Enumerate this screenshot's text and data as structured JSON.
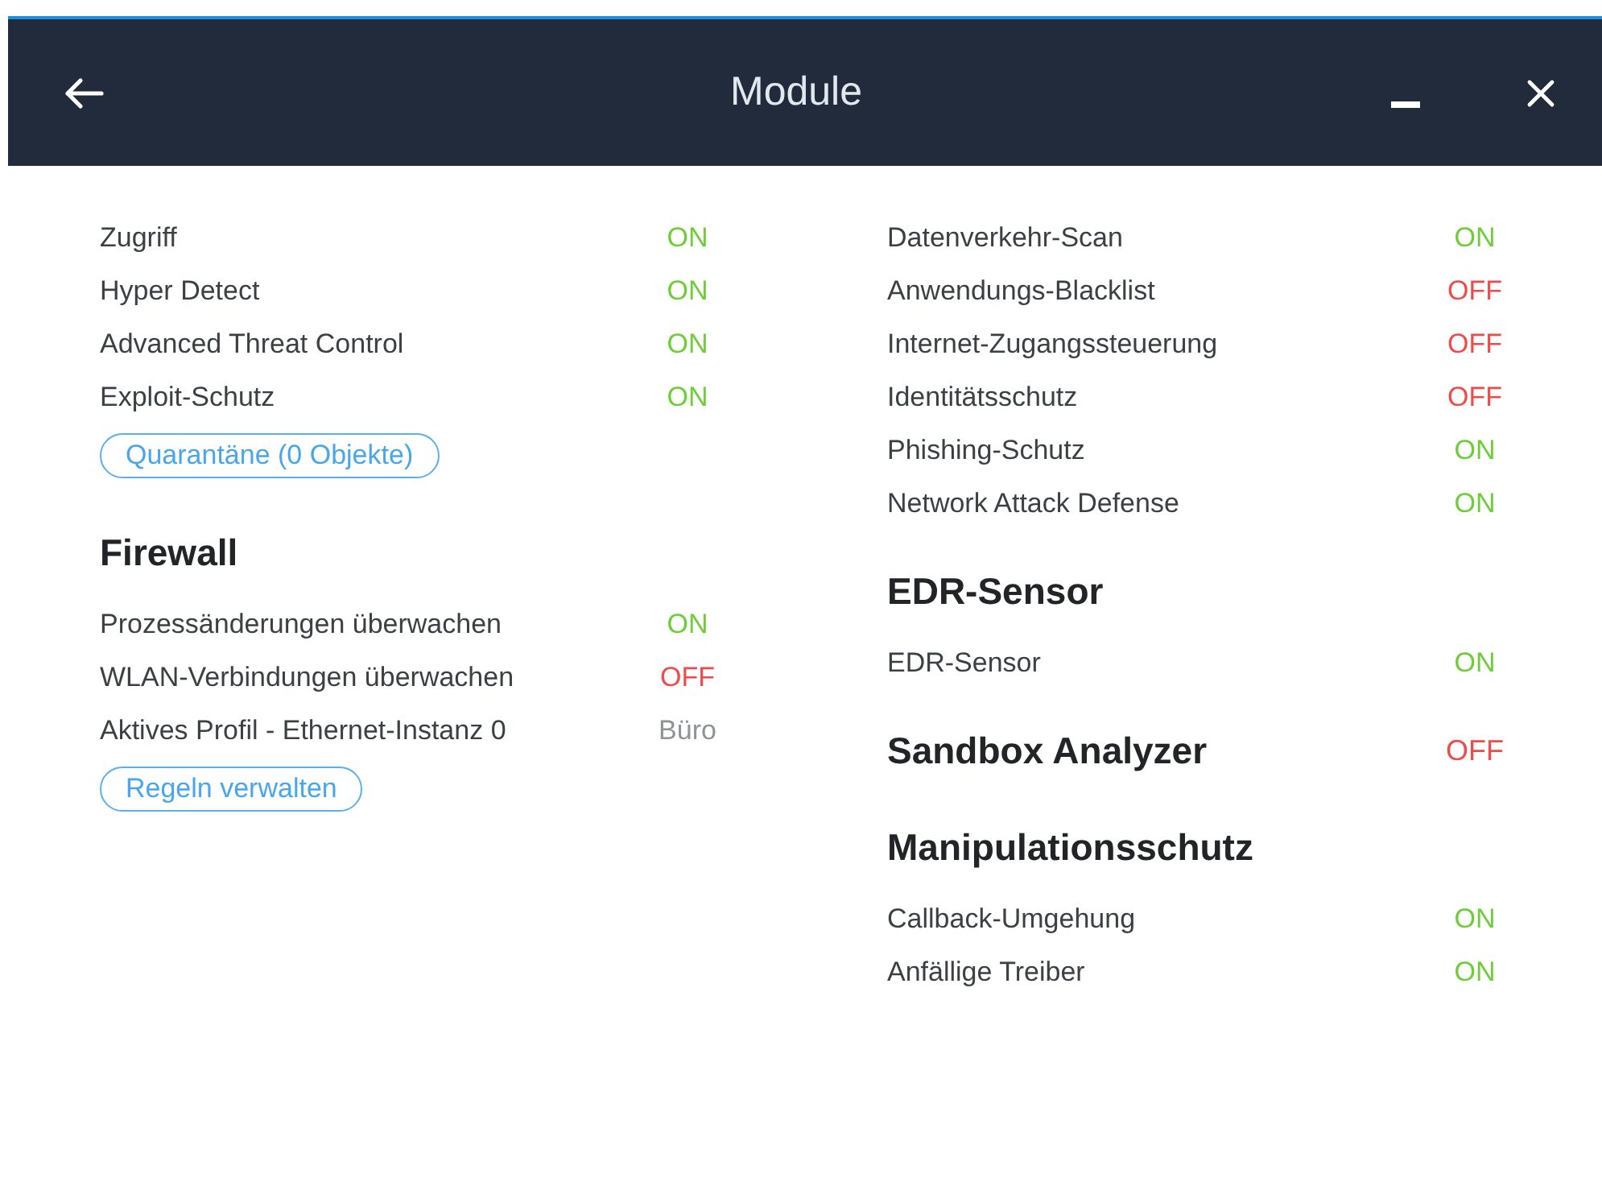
{
  "window": {
    "title": "Module"
  },
  "columns": [
    {
      "blocks": [
        {
          "kind": "list",
          "rows": [
            {
              "label": "Zugriff",
              "status": "ON",
              "color": "#6fcd3a"
            },
            {
              "label": "Hyper Detect",
              "status": "ON",
              "color": "#6fcd3a"
            },
            {
              "label": "Advanced Threat Control",
              "status": "ON",
              "color": "#6fcd3a"
            },
            {
              "label": "Exploit-Schutz",
              "status": "ON",
              "color": "#6fcd3a"
            }
          ]
        },
        {
          "kind": "button",
          "label": "Quarantäne (0 Objekte)"
        },
        {
          "kind": "heading",
          "title": "Firewall"
        },
        {
          "kind": "list",
          "rows": [
            {
              "label": "Prozessänderungen überwachen",
              "status": "ON",
              "color": "#6fcd3a"
            },
            {
              "label": "WLAN-Verbindungen überwachen",
              "status": "OFF",
              "color": "#ee4b4b"
            },
            {
              "label": "Aktives Profil - Ethernet-Instanz 0",
              "status": "Büro",
              "color": "#8f9296"
            }
          ]
        },
        {
          "kind": "button",
          "label": "Regeln verwalten"
        }
      ]
    },
    {
      "blocks": [
        {
          "kind": "list",
          "rows": [
            {
              "label": "Datenverkehr-Scan",
              "status": "ON",
              "color": "#6fcd3a"
            },
            {
              "label": "Anwendungs-Blacklist",
              "status": "OFF",
              "color": "#ee4b4b"
            },
            {
              "label": "Internet-Zugangssteuerung",
              "status": "OFF",
              "color": "#ee4b4b"
            },
            {
              "label": "Identitätsschutz",
              "status": "OFF",
              "color": "#ee4b4b"
            },
            {
              "label": "Phishing-Schutz",
              "status": "ON",
              "color": "#6fcd3a"
            },
            {
              "label": "Network Attack Defense",
              "status": "ON",
              "color": "#6fcd3a"
            }
          ]
        },
        {
          "kind": "heading",
          "title": "EDR-Sensor"
        },
        {
          "kind": "list",
          "rows": [
            {
              "label": "EDR-Sensor",
              "status": "ON",
              "color": "#6fcd3a"
            }
          ]
        },
        {
          "kind": "heading",
          "title": "Sandbox Analyzer",
          "status": "OFF",
          "color": "#ee4b4b"
        },
        {
          "kind": "heading",
          "title": "Manipulationsschutz"
        },
        {
          "kind": "list",
          "rows": [
            {
              "label": "Callback-Umgehung",
              "status": "ON",
              "color": "#6fcd3a"
            },
            {
              "label": "Anfällige Treiber",
              "status": "ON",
              "color": "#6fcd3a"
            }
          ]
        }
      ]
    }
  ]
}
